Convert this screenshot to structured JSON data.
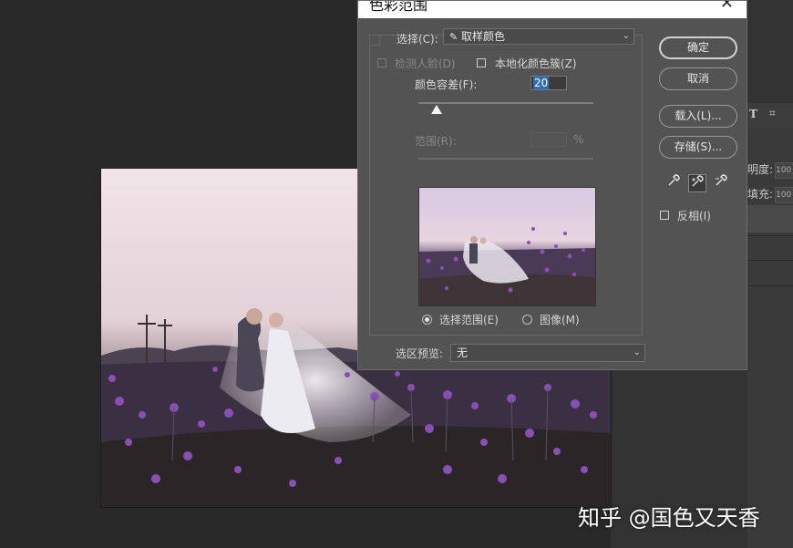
{
  "dialog": {
    "title": "色彩范围",
    "select_label": "选择(C):",
    "select_value": "取样颜色",
    "detect_faces_label": "检测人脸(D)",
    "localized_clusters_label": "本地化颜色簇(Z)",
    "fuzziness_label": "颜色容差(F):",
    "fuzziness_value": "20",
    "fuzziness_level_fraction": 0.1,
    "range_label": "范围(R):",
    "range_unit": "%",
    "radio_selection_label": "选择范围(E)",
    "radio_image_label": "图像(M)",
    "selected_view": "选择范围(E)",
    "preview_label": "选区预览:",
    "preview_value": "无",
    "invert_label": "反相(I)",
    "buttons": {
      "ok": "确定",
      "cancel": "取消",
      "load": "载入(L)...",
      "save": "存储(S)..."
    },
    "tools": [
      "eyedropper-icon",
      "eyedropper-plus-icon",
      "eyedropper-minus-icon"
    ],
    "close_glyph": "✕"
  },
  "panel": {
    "opacity_label": "明度:",
    "opacity_value": "100",
    "fill_label": "填充:",
    "fill_value": "100"
  },
  "watermark": "知乎 @国色又天香",
  "colors": {
    "dialog_bg": "#535353",
    "highlight": "#2b6db7",
    "app_bg": "#282828"
  }
}
